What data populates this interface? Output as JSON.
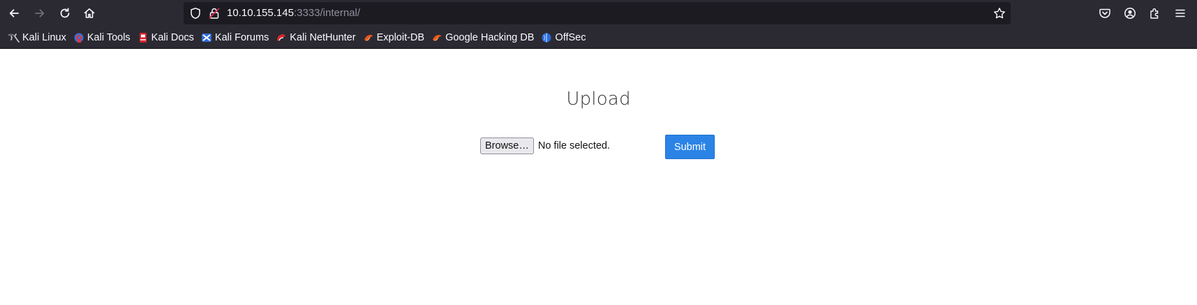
{
  "browser": {
    "url_host": "10.10.155.145",
    "url_rest": ":3333/internal/",
    "icons": {
      "back": "back-arrow-icon",
      "forward": "forward-arrow-icon",
      "reload": "reload-icon",
      "home": "home-icon",
      "shield": "tracking-shield-icon",
      "lock": "insecure-lock-icon",
      "star": "bookmark-star-icon",
      "pocket": "pocket-icon",
      "account": "account-icon",
      "extensions": "extensions-icon",
      "menu": "hamburger-menu-icon"
    },
    "colors": {
      "chrome": "#2b2a33",
      "urlbar": "#1c1b22",
      "text": "#fbfbfe",
      "muted_text": "#8f8f9d"
    }
  },
  "bookmarks": [
    {
      "label": "Kali Linux",
      "icon": "kali-dragon-icon"
    },
    {
      "label": "Kali Tools",
      "icon": "kali-tools-icon"
    },
    {
      "label": "Kali Docs",
      "icon": "kali-docs-icon"
    },
    {
      "label": "Kali Forums",
      "icon": "kali-forums-icon"
    },
    {
      "label": "Kali NetHunter",
      "icon": "kali-nethunter-icon"
    },
    {
      "label": "Exploit-DB",
      "icon": "exploit-db-icon"
    },
    {
      "label": "Google Hacking DB",
      "icon": "ghdb-icon"
    },
    {
      "label": "OffSec",
      "icon": "offsec-icon"
    }
  ],
  "page": {
    "title": "Upload",
    "browse_label": "Browse…",
    "file_status": "No file selected.",
    "submit_label": "Submit",
    "colors": {
      "submit_bg": "#2c83e6",
      "title_text": "#333333"
    }
  }
}
